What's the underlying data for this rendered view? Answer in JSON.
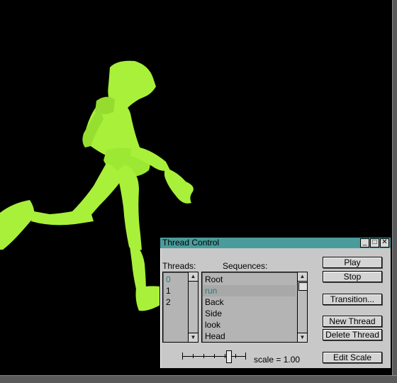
{
  "window": {
    "title": "Thread Control",
    "controls": {
      "minimize": "_",
      "maximize": "□",
      "close": "✕"
    }
  },
  "threads": {
    "label": "Threads:",
    "items": [
      "0",
      "1",
      "2"
    ],
    "selected_index": 0
  },
  "sequences": {
    "label": "Sequences:",
    "items": [
      "Root",
      "run",
      "Back",
      "Side",
      "look",
      "Head"
    ],
    "selected_index": 1
  },
  "buttons": {
    "play": "Play",
    "stop": "Stop",
    "transition": "Transition...",
    "new_thread": "New Thread",
    "delete_thread": "Delete Thread",
    "edit_scale": "Edit Scale"
  },
  "scale": {
    "text": "scale = 1.00"
  },
  "colors": {
    "figure": "#a8f03a",
    "titlebar": "#4a9c9c",
    "panel": "#c8c8c8"
  }
}
